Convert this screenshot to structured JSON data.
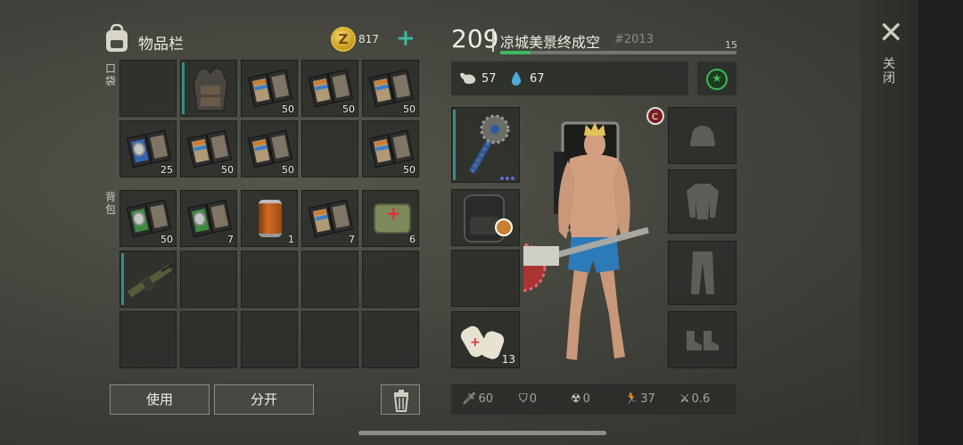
{
  "inventory": {
    "title": "物品栏",
    "coins": "817",
    "coin_symbol": "Z",
    "add_symbol": "+",
    "pocket_label": "口袋",
    "backpack_label": "背包"
  },
  "slots": [
    {
      "item": "",
      "count": ""
    },
    {
      "item": "tactical-vest",
      "count": ""
    },
    {
      "item": "book-orange",
      "count": "50"
    },
    {
      "item": "book-orange",
      "count": "50"
    },
    {
      "item": "book-orange",
      "count": "50"
    },
    {
      "item": "book-blue-medal",
      "count": "25"
    },
    {
      "item": "book-orange",
      "count": "50"
    },
    {
      "item": "book-orange",
      "count": "50"
    },
    {
      "item": "",
      "count": ""
    },
    {
      "item": "book-orange",
      "count": "50"
    },
    {
      "item": "book-green-medal",
      "count": "50"
    },
    {
      "item": "book-green-medal",
      "count": "7"
    },
    {
      "item": "canned-food",
      "count": "1"
    },
    {
      "item": "book-orange",
      "count": "7"
    },
    {
      "item": "medical-bag",
      "count": "6"
    },
    {
      "item": "assault-rifle",
      "count": ""
    },
    {
      "item": "",
      "count": ""
    },
    {
      "item": "",
      "count": ""
    },
    {
      "item": "",
      "count": ""
    },
    {
      "item": "",
      "count": ""
    },
    {
      "item": "",
      "count": ""
    },
    {
      "item": "",
      "count": ""
    },
    {
      "item": "",
      "count": ""
    },
    {
      "item": "",
      "count": ""
    },
    {
      "item": "",
      "count": ""
    }
  ],
  "actions": {
    "use": "使用",
    "split": "分开"
  },
  "player": {
    "level": "209",
    "name": "凉城美景终成空",
    "id": "#2013",
    "xp_label": "15",
    "xp_progress": 0.13,
    "food": "57",
    "water": "67"
  },
  "equipment": {
    "bandage_count": "13",
    "badge_letter": "C"
  },
  "combat_stats": {
    "attack": "60",
    "defense": "0",
    "radiation": "0",
    "speed": "37",
    "stealth": "0.6"
  },
  "close_label": "关闭",
  "colors": {
    "accent": "#3fb8a0",
    "xp": "#3fb85a",
    "durability": "#3a8a8a",
    "coin": "#e0b73b"
  }
}
